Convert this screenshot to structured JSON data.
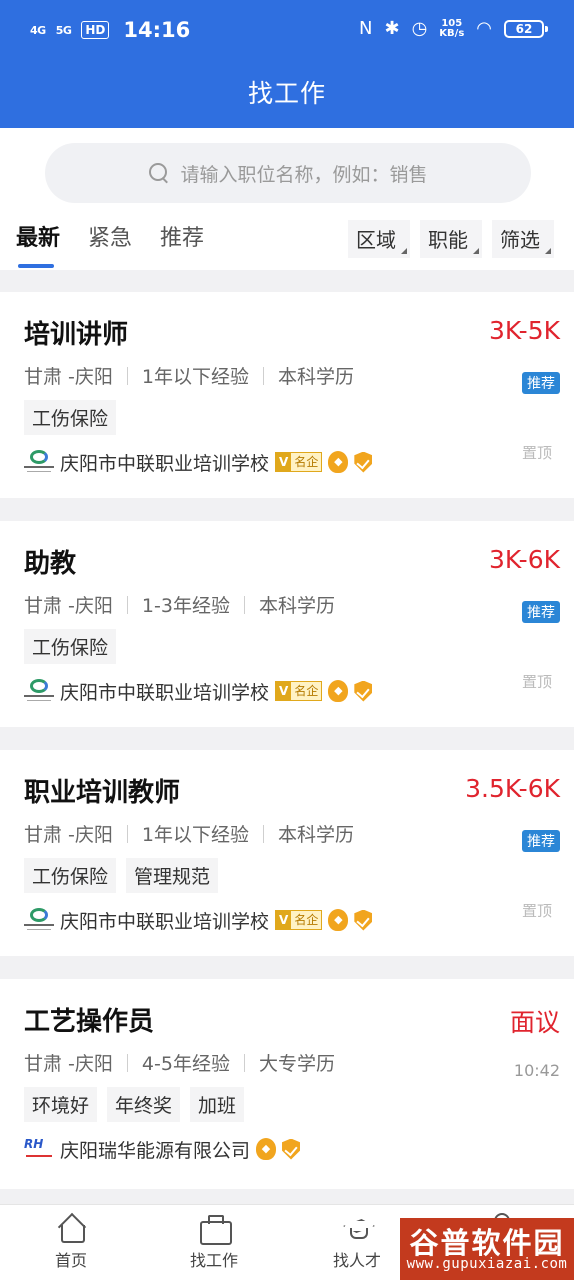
{
  "status_bar": {
    "signal_4g": "4G",
    "signal_5g": "5G",
    "hd": "HD",
    "time": "14:16",
    "net_speed": "105",
    "net_unit": "KB/s",
    "battery": "62"
  },
  "header": {
    "title": "找工作"
  },
  "search": {
    "placeholder": "请输入职位名称，例如：销售"
  },
  "tabs": [
    {
      "label": "最新",
      "active": true
    },
    {
      "label": "紧急",
      "active": false
    },
    {
      "label": "推荐",
      "active": false
    }
  ],
  "filters": [
    {
      "label": "区域"
    },
    {
      "label": "职能"
    },
    {
      "label": "筛选"
    }
  ],
  "jobs": [
    {
      "title": "培训讲师",
      "salary": "3K-5K",
      "location": "甘肃 -庆阳",
      "experience": "1年以下经验",
      "education": "本科学历",
      "badge": "推荐",
      "tags": [
        "工伤保险"
      ],
      "company": "庆阳市中联职业培训学校",
      "cert": "名企",
      "pin": "置顶"
    },
    {
      "title": "助教",
      "salary": "3K-6K",
      "location": "甘肃 -庆阳",
      "experience": "1-3年经验",
      "education": "本科学历",
      "badge": "推荐",
      "tags": [
        "工伤保险"
      ],
      "company": "庆阳市中联职业培训学校",
      "cert": "名企",
      "pin": "置顶"
    },
    {
      "title": "职业培训教师",
      "salary": "3.5K-6K",
      "location": "甘肃 -庆阳",
      "experience": "1年以下经验",
      "education": "本科学历",
      "badge": "推荐",
      "tags": [
        "工伤保险",
        "管理规范"
      ],
      "company": "庆阳市中联职业培训学校",
      "cert": "名企",
      "pin": "置顶"
    },
    {
      "title": "工艺操作员",
      "salary": "面议",
      "location": "甘肃 -庆阳",
      "experience": "4-5年经验",
      "education": "大专学历",
      "time": "10:42",
      "tags": [
        "环境好",
        "年终奖",
        "加班"
      ],
      "company": "庆阳瑞华能源有限公司"
    }
  ],
  "tabbar": [
    {
      "label": "首页",
      "icon": "home-icon"
    },
    {
      "label": "找工作",
      "icon": "briefcase-icon"
    },
    {
      "label": "找人才",
      "icon": "graduation-cap-icon"
    }
  ],
  "watermark": {
    "name": "谷普软件园",
    "url": "www.gupuxiazai.com"
  },
  "colors": {
    "primary": "#2f6fe0",
    "salary": "#e0242e",
    "badge": "#2b86d6",
    "gold": "#f1a51e"
  }
}
